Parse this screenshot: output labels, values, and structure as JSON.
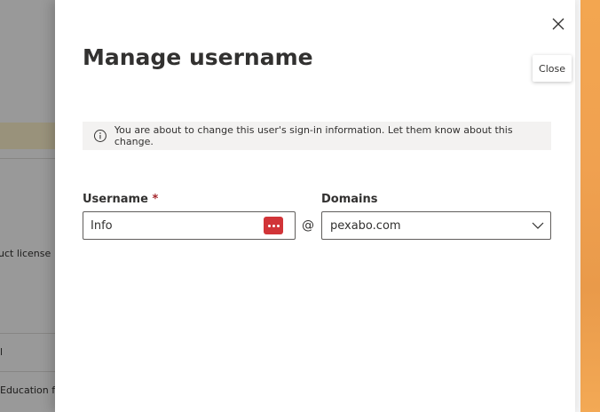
{
  "background": {
    "fragments": [
      "uct license",
      "l",
      "Education fo"
    ]
  },
  "panel": {
    "title": "Manage username",
    "close_tooltip": "Close",
    "info_message": "You are about to change this user's sign-in information. Let them know about this change.",
    "username": {
      "label": "Username",
      "required_marker": "*",
      "value": "Info"
    },
    "at_symbol": "@",
    "domains": {
      "label": "Domains",
      "selected": "pexabo.com"
    }
  },
  "colors": {
    "required": "#a4262c",
    "password_badge": "#d13438",
    "info_bar": "#f3f2f1"
  }
}
